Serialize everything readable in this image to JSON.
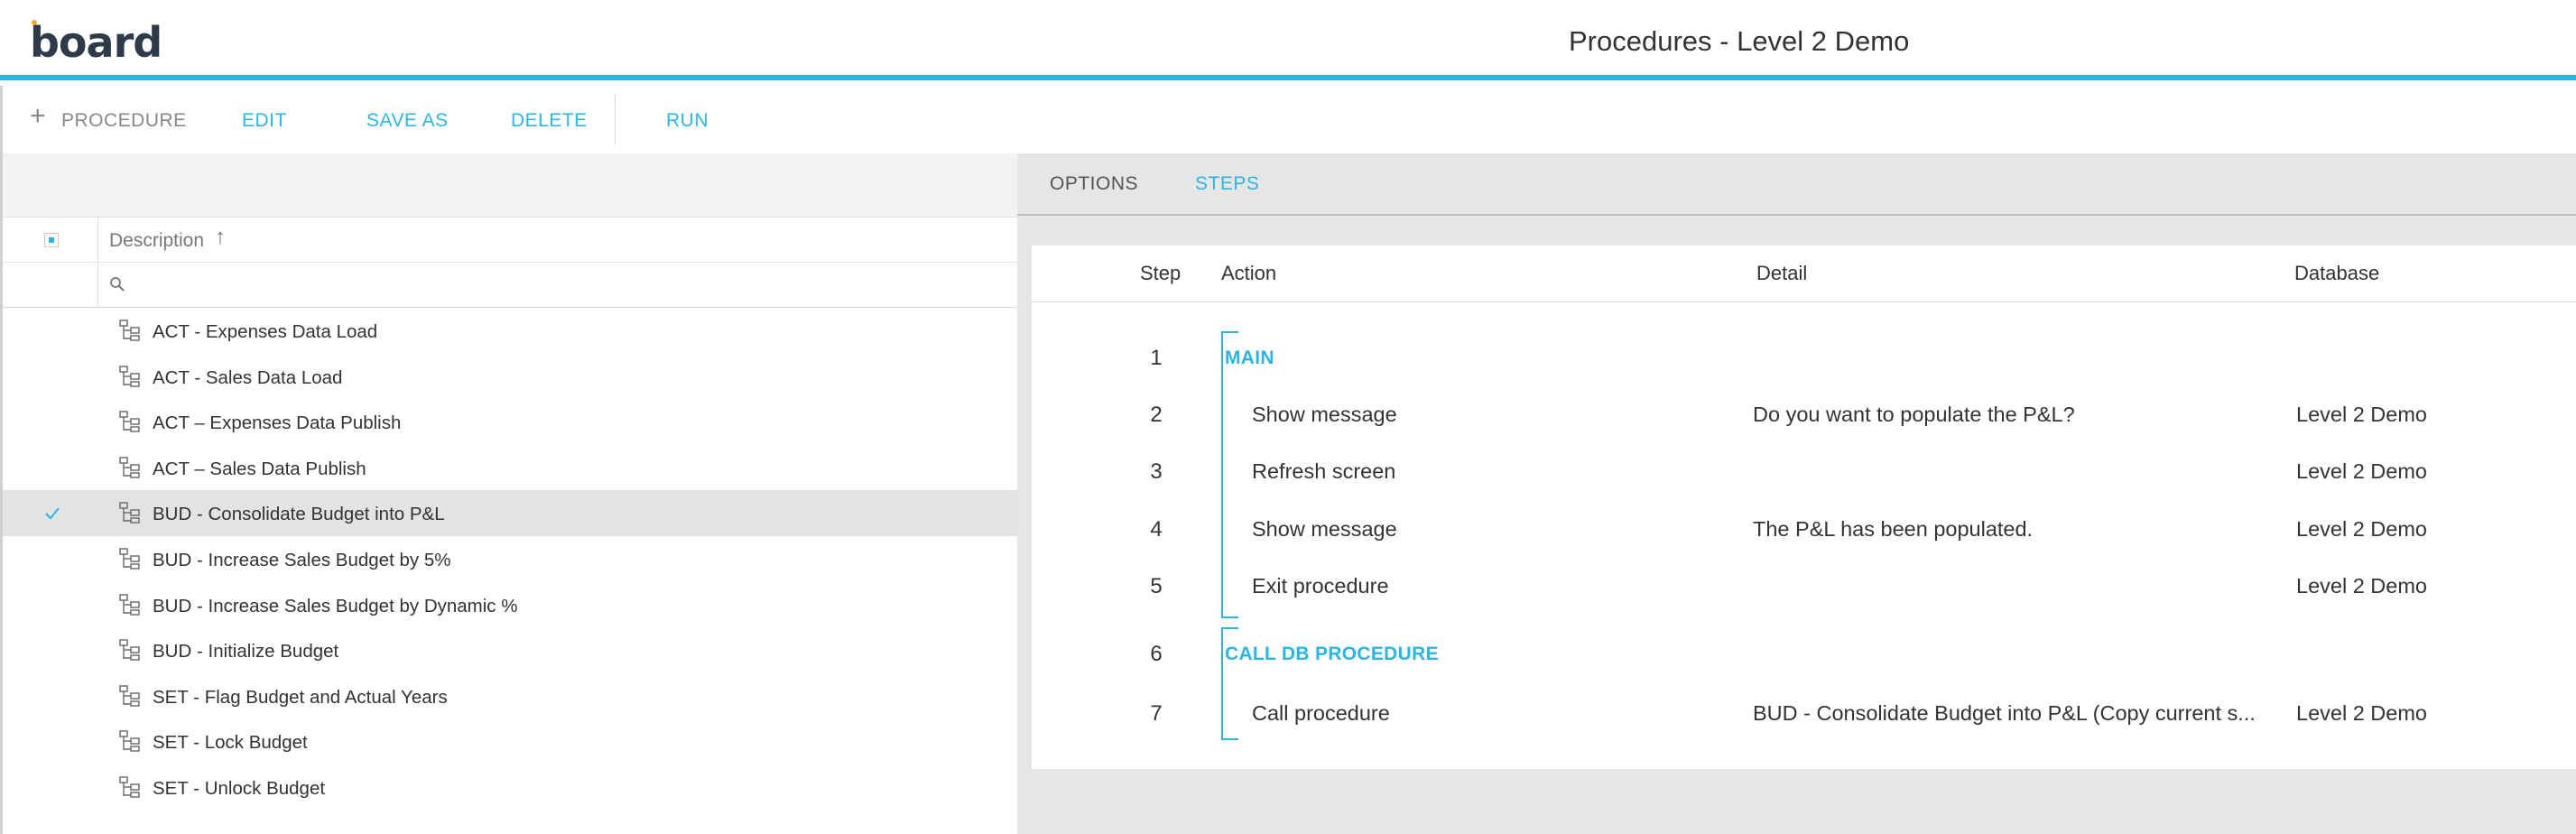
{
  "header": {
    "logo_text": "board",
    "title": "Procedures - Level 2 Demo"
  },
  "toolbar": {
    "procedure_label": "PROCEDURE",
    "edit_label": "EDIT",
    "save_as_label": "SAVE AS",
    "delete_label": "DELETE",
    "run_label": "RUN"
  },
  "grid": {
    "column_description": "Description",
    "rows": [
      {
        "label": "ACT - Expenses Data Load",
        "selected": false
      },
      {
        "label": "ACT - Sales Data Load",
        "selected": false
      },
      {
        "label": "ACT – Expenses Data Publish",
        "selected": false
      },
      {
        "label": "ACT – Sales Data Publish",
        "selected": false
      },
      {
        "label": "BUD - Consolidate Budget into P&L",
        "selected": true
      },
      {
        "label": "BUD - Increase Sales Budget by 5%",
        "selected": false
      },
      {
        "label": "BUD - Increase Sales Budget by Dynamic %",
        "selected": false
      },
      {
        "label": "BUD - Initialize Budget",
        "selected": false
      },
      {
        "label": "SET - Flag Budget and Actual Years",
        "selected": false
      },
      {
        "label": "SET - Lock Budget",
        "selected": false
      },
      {
        "label": "SET - Unlock Budget",
        "selected": false
      }
    ]
  },
  "tabs": {
    "options_label": "OPTIONS",
    "steps_label": "STEPS",
    "active": "STEPS"
  },
  "steps": {
    "headers": {
      "step": "Step",
      "action": "Action",
      "detail": "Detail",
      "database": "Database"
    },
    "rows": [
      {
        "step": "1",
        "group": "MAIN",
        "action": "",
        "detail": "",
        "database": ""
      },
      {
        "step": "2",
        "group": "",
        "action": "Show message",
        "detail": "Do you want to populate the P&L?",
        "database": "Level 2 Demo"
      },
      {
        "step": "3",
        "group": "",
        "action": "Refresh screen",
        "detail": "",
        "database": "Level 2 Demo"
      },
      {
        "step": "4",
        "group": "",
        "action": "Show message",
        "detail": "The P&L has been populated.",
        "database": "Level 2 Demo"
      },
      {
        "step": "5",
        "group": "",
        "action": "Exit procedure",
        "detail": "",
        "database": "Level 2 Demo"
      },
      {
        "step": "6",
        "group": "CALL DB PROCEDURE",
        "action": "",
        "detail": "",
        "database": ""
      },
      {
        "step": "7",
        "group": "",
        "action": "Call procedure",
        "detail": "BUD - Consolidate Budget into P&L (Copy current s...",
        "database": "Level 2 Demo"
      }
    ]
  },
  "colors": {
    "accent": "#2bb5e3",
    "selected_row": "#e3e3e3",
    "panel_gray": "#e6e6e6"
  },
  "icons": {
    "add": "plus-icon",
    "sort": "sort-ascending-icon",
    "filter": "search-icon",
    "row": "procedure-icon",
    "selected": "checkmark-icon"
  }
}
